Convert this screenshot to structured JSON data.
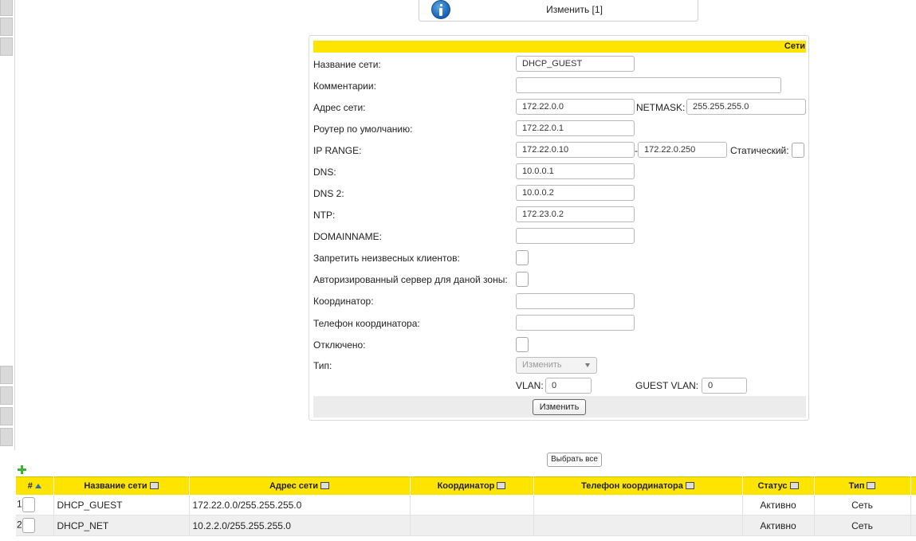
{
  "info": {
    "title": "Изменить [1]"
  },
  "panel": {
    "header": "Сети"
  },
  "form": {
    "network_name": {
      "label": "Название сети:",
      "value": "DHCP_GUEST"
    },
    "comments": {
      "label": "Комментарии:",
      "value": ""
    },
    "network_address": {
      "label": "Адрес сети:",
      "value": "172.22.0.0",
      "netmask_label": "NETMASK:",
      "netmask_value": "255.255.255.0"
    },
    "default_router": {
      "label": "Роутер по умолчанию:",
      "value": "172.22.0.1"
    },
    "ip_range": {
      "label": "IP RANGE:",
      "from": "172.22.0.10",
      "separator": "-",
      "to": "172.22.0.250",
      "static_label": "Статический:"
    },
    "dns": {
      "label": "DNS:",
      "value": "10.0.0.1"
    },
    "dns2": {
      "label": "DNS 2:",
      "value": "10.0.0.2"
    },
    "ntp": {
      "label": "NTP:",
      "value": "172.23.0.2"
    },
    "domainname": {
      "label": "DOMAINNAME:",
      "value": ""
    },
    "deny_unknown": {
      "label": "Запретить неизвесных клиентов:"
    },
    "authoritative": {
      "label": "Авторизированный сервер для даной зоны:"
    },
    "coordinator": {
      "label": "Координатор:",
      "value": ""
    },
    "coordinator_phone": {
      "label": "Телефон координатора:",
      "value": ""
    },
    "disabled": {
      "label": "Отключено:"
    },
    "type": {
      "label": "Тип:",
      "selected": "Изменить"
    },
    "vlan": {
      "label": "VLAN:",
      "value": "0"
    },
    "guest_vlan": {
      "label": "GUEST VLAN:",
      "value": "0"
    },
    "submit_label": "Изменить"
  },
  "table": {
    "select_all_label": "Выбрать все",
    "columns": [
      "#",
      "Название сети",
      "Адрес сети",
      "Координатор",
      "Телефон координатора",
      "Статус",
      "Тип"
    ],
    "rows": [
      {
        "num": "1",
        "name": "DHCP_GUEST",
        "address": "172.22.0.0/255.255.255.0",
        "coordinator": "",
        "phone": "",
        "status": "Активно",
        "type": "Сеть"
      },
      {
        "num": "2",
        "name": "DHCP_NET",
        "address": "10.2.2.0/255.255.255.0",
        "coordinator": "",
        "phone": "",
        "status": "Активно",
        "type": "Сеть"
      }
    ]
  },
  "colors": {
    "accent_yellow": "#ffe400",
    "footer_gray": "#ececec"
  }
}
